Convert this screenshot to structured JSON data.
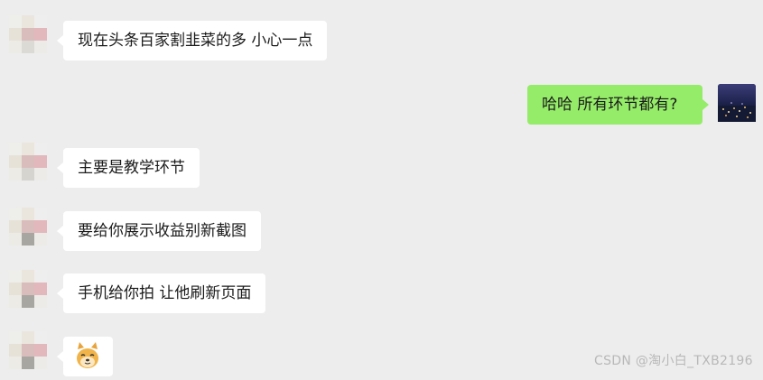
{
  "conversation": {
    "messages": [
      {
        "side": "left",
        "text": "现在头条百家割韭菜的多 小心一点"
      },
      {
        "side": "right",
        "text": "哈哈 所有环节都有?"
      },
      {
        "side": "left",
        "text": "主要是教学环节"
      },
      {
        "side": "left",
        "text": "要给你展示收益别新截图"
      },
      {
        "side": "left",
        "text": "手机给你拍 让他刷新页面"
      },
      {
        "side": "left",
        "emoji": "doge-emoji"
      }
    ]
  },
  "watermark": {
    "text": "CSDN @淘小白_TXB2196"
  },
  "colors": {
    "background": "#ededed",
    "incoming_bubble": "#ffffff",
    "outgoing_bubble": "#95ec69"
  },
  "icons": {
    "contact_avatar": "blurred-avatar-icon",
    "self_avatar": "night-city-avatar-icon",
    "sticker": "doge-emoji"
  }
}
